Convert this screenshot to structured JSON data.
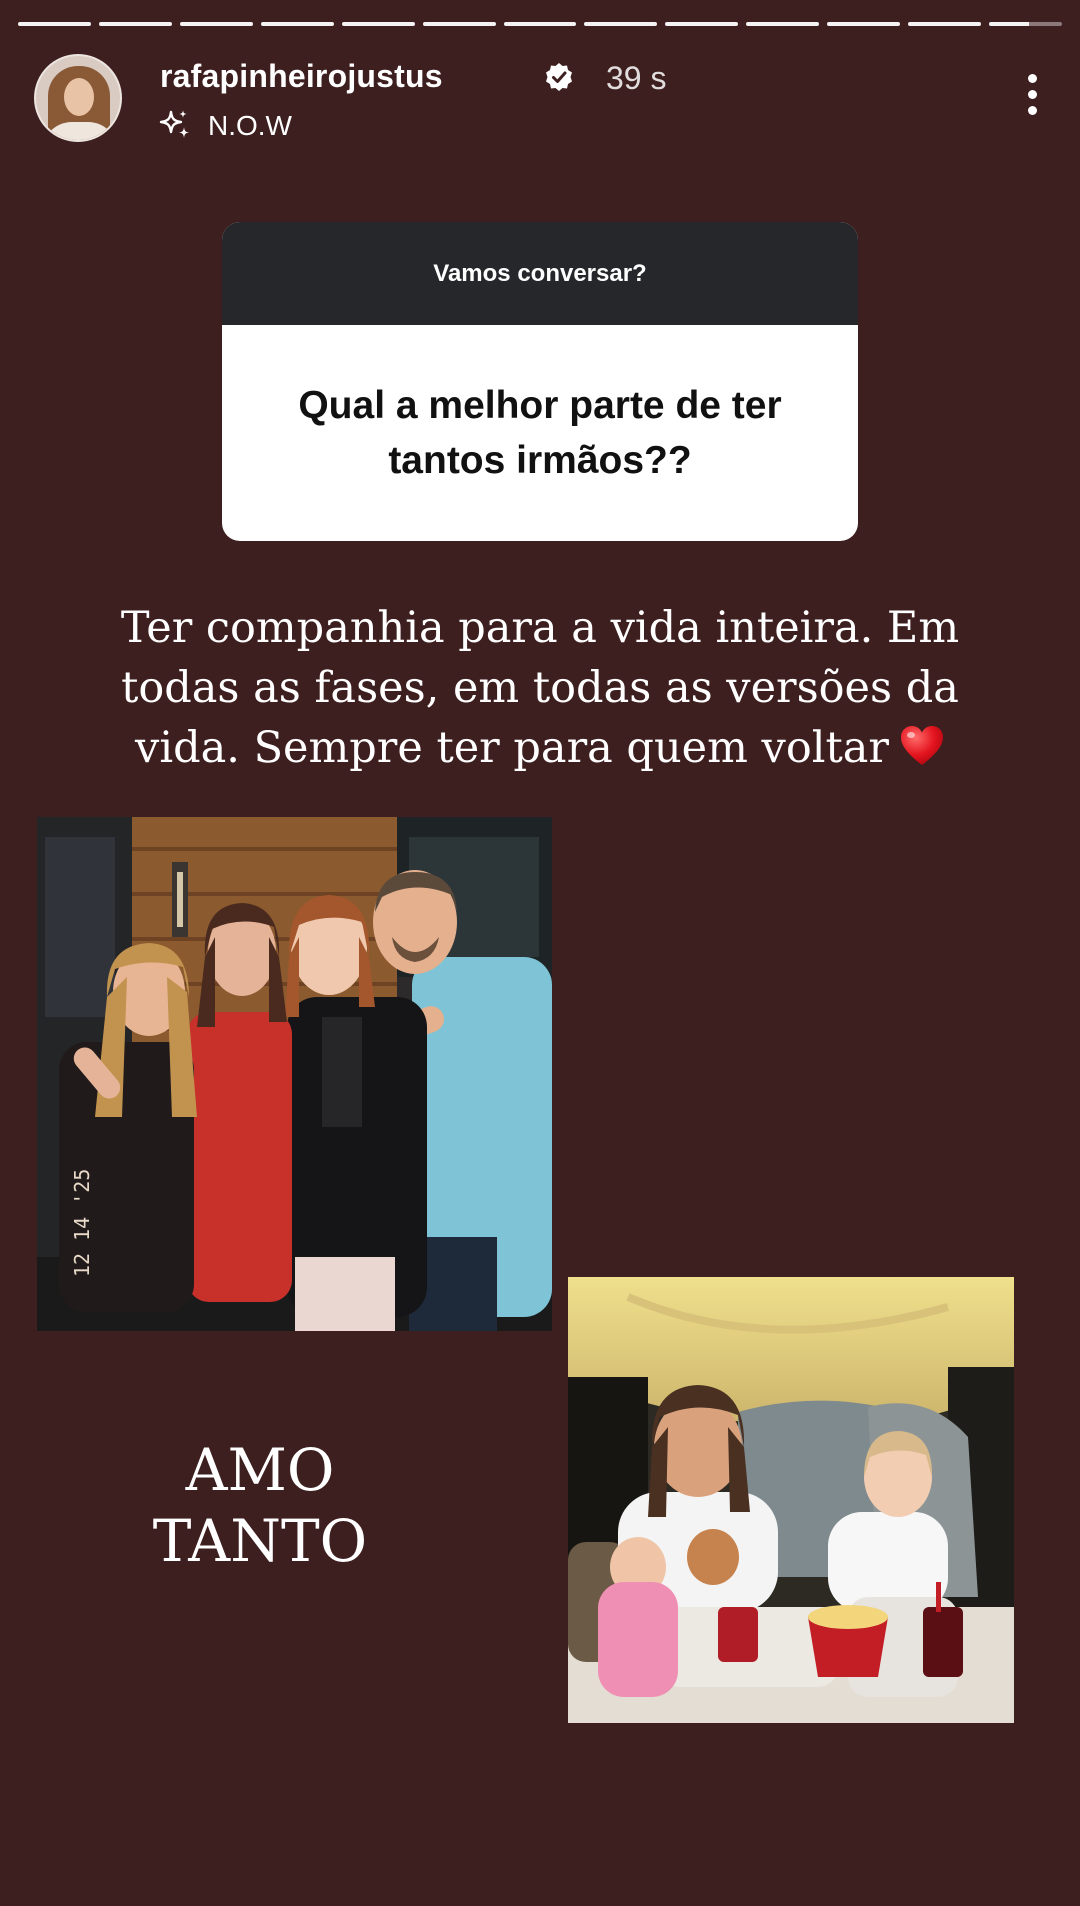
{
  "story": {
    "segments": 13,
    "current_segment": 13
  },
  "header": {
    "username": "rafapinheirojustus",
    "verified_icon": "verified-badge-icon",
    "time": "39 s",
    "subtitle_icon": "sparkle-icon",
    "subtitle": "N.O.W",
    "menu_icon": "more-vertical-icon"
  },
  "question_sticker": {
    "title": "Vamos conversar?",
    "question": "Qual a melhor parte de ter tantos irmãos??"
  },
  "answer": {
    "line1": "Ter companhia para a vida inteira. Em",
    "line2": "todas as fases, em todas as versões da",
    "line3": "vida. Sempre ter para quem voltar",
    "emoji_icon": "red-heart-icon"
  },
  "photo1": {
    "date_stamp": "12 14 '25"
  },
  "caption": {
    "line1": "AMO",
    "line2": "TANTO"
  },
  "colors": {
    "background": "#3e1f20",
    "sticker_header": "#26272b",
    "sticker_body": "#ffffff"
  }
}
